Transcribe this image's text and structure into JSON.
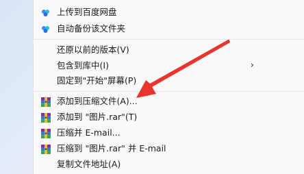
{
  "menu": {
    "items": [
      {
        "label": "上传到百度网盘",
        "icon": "baidu-netdisk-icon"
      },
      {
        "label": "自动备份该文件夹",
        "icon": "baidu-netdisk-icon"
      },
      {
        "label": "还原以前的版本(V)"
      },
      {
        "label": "包含到库中(I)",
        "submenu_arrow": "›"
      },
      {
        "label": "固定到\"开始\"屏幕(P)"
      },
      {
        "label": "添加到压缩文件(A)...",
        "icon": "winrar-icon"
      },
      {
        "label": "添加到 \"图片.rar\"(T)",
        "icon": "winrar-icon"
      },
      {
        "label": "压缩并 E-mail...",
        "icon": "winrar-icon"
      },
      {
        "label": "压缩到 \"图片.rar\" 并 E-mail",
        "icon": "winrar-icon"
      },
      {
        "label": "复制文件地址(A)"
      }
    ]
  },
  "annotation": {
    "color": "#e8352e"
  }
}
